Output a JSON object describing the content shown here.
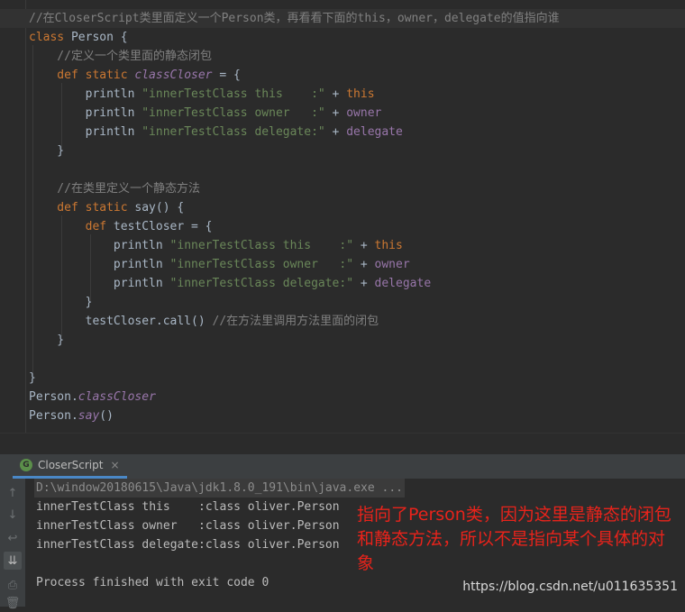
{
  "editor": {
    "lines": [
      {
        "tokens": [
          {
            "t": "//在CloserScript类里面定义一个Person类，再看看下面的this，owner，delegate的值指向谁",
            "c": "cm"
          }
        ]
      },
      {
        "tokens": [
          {
            "t": "class ",
            "c": "kw"
          },
          {
            "t": "Person {",
            "c": "plain"
          }
        ]
      },
      {
        "tokens": [
          {
            "t": "    //定义一个类里面的静态闭包",
            "c": "cm"
          }
        ]
      },
      {
        "tokens": [
          {
            "t": "    def static ",
            "c": "kw"
          },
          {
            "t": "classCloser",
            "c": "fld"
          },
          {
            "t": " = {",
            "c": "plain"
          }
        ]
      },
      {
        "tokens": [
          {
            "t": "        println ",
            "c": "plain"
          },
          {
            "t": "\"innerTestClass this    :\"",
            "c": "str"
          },
          {
            "t": " + ",
            "c": "plain"
          },
          {
            "t": "this",
            "c": "kw"
          }
        ]
      },
      {
        "tokens": [
          {
            "t": "        println ",
            "c": "plain"
          },
          {
            "t": "\"innerTestClass owner   :\"",
            "c": "str"
          },
          {
            "t": " + ",
            "c": "plain"
          },
          {
            "t": "owner",
            "c": "prop"
          }
        ]
      },
      {
        "tokens": [
          {
            "t": "        println ",
            "c": "plain"
          },
          {
            "t": "\"innerTestClass delegate:\"",
            "c": "str"
          },
          {
            "t": " + ",
            "c": "plain"
          },
          {
            "t": "delegate",
            "c": "prop"
          }
        ]
      },
      {
        "tokens": [
          {
            "t": "    }",
            "c": "plain"
          }
        ]
      },
      {
        "tokens": [
          {
            "t": "",
            "c": "plain"
          }
        ]
      },
      {
        "tokens": [
          {
            "t": "    //在类里定义一个静态方法",
            "c": "cm"
          }
        ]
      },
      {
        "tokens": [
          {
            "t": "    def static ",
            "c": "kw"
          },
          {
            "t": "say() {",
            "c": "plain"
          }
        ]
      },
      {
        "tokens": [
          {
            "t": "        def ",
            "c": "kw"
          },
          {
            "t": "testCloser = {",
            "c": "plain"
          }
        ]
      },
      {
        "tokens": [
          {
            "t": "            println ",
            "c": "plain"
          },
          {
            "t": "\"innerTestClass this    :\"",
            "c": "str"
          },
          {
            "t": " + ",
            "c": "plain"
          },
          {
            "t": "this",
            "c": "kw"
          }
        ]
      },
      {
        "tokens": [
          {
            "t": "            println ",
            "c": "plain"
          },
          {
            "t": "\"innerTestClass owner   :\"",
            "c": "str"
          },
          {
            "t": " + ",
            "c": "plain"
          },
          {
            "t": "owner",
            "c": "prop"
          }
        ]
      },
      {
        "tokens": [
          {
            "t": "            println ",
            "c": "plain"
          },
          {
            "t": "\"innerTestClass delegate:\"",
            "c": "str"
          },
          {
            "t": " + ",
            "c": "plain"
          },
          {
            "t": "delegate",
            "c": "prop"
          }
        ]
      },
      {
        "tokens": [
          {
            "t": "        }",
            "c": "plain"
          }
        ]
      },
      {
        "tokens": [
          {
            "t": "        testCloser.call() ",
            "c": "plain"
          },
          {
            "t": "//在方法里调用方法里面的闭包",
            "c": "cm"
          }
        ]
      },
      {
        "tokens": [
          {
            "t": "    }",
            "c": "plain"
          }
        ]
      },
      {
        "tokens": [
          {
            "t": "",
            "c": "plain"
          }
        ]
      },
      {
        "tokens": [
          {
            "t": "}",
            "c": "plain"
          }
        ]
      },
      {
        "tokens": [
          {
            "t": "Person.",
            "c": "plain"
          },
          {
            "t": "classCloser",
            "c": "fld"
          }
        ]
      },
      {
        "tokens": [
          {
            "t": "Person.",
            "c": "plain"
          },
          {
            "t": "say",
            "c": "fld"
          },
          {
            "t": "()",
            "c": "plain"
          }
        ]
      }
    ]
  },
  "run_panel": {
    "tab_label": "CloserScript",
    "tab_icon_glyph": "G",
    "close_glyph": "×"
  },
  "toolbar": {
    "up": "↑",
    "down": "↓",
    "wrap": "↩",
    "scroll_end": "⇊",
    "print": "⎙",
    "trash": "🗑"
  },
  "console": {
    "command": "D:\\window20180615\\Java\\jdk1.8.0_191\\bin\\java.exe ...",
    "output": [
      "innerTestClass this    :class oliver.Person",
      "innerTestClass owner   :class oliver.Person",
      "innerTestClass delegate:class oliver.Person"
    ],
    "exit_message": "Process finished with exit code 0"
  },
  "annotation": {
    "text": "指向了Person类，因为这里是静态的闭包和静态方法，所以不是指向某个具体的对象"
  },
  "watermark": "https://blog.csdn.net/u011635351",
  "colors": {
    "background": "#2b2b2b",
    "keyword": "#cc7832",
    "string": "#6a8759",
    "comment": "#808080",
    "field": "#9876aa",
    "annotation": "#e8231b"
  }
}
